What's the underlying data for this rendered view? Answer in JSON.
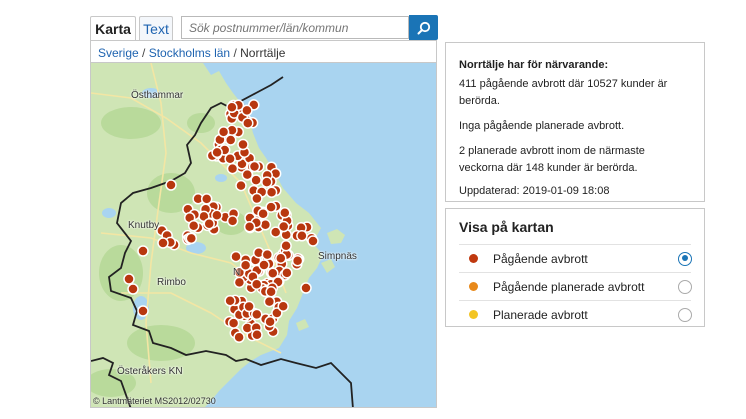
{
  "tabs": {
    "karta": "Karta",
    "text": "Text"
  },
  "search": {
    "placeholder": "Sök postnummer/län/kommun"
  },
  "breadcrumb": {
    "sverige": "Sverige",
    "lan": "Stockholms län",
    "kommun": "Norrtälje",
    "separator": "/"
  },
  "map": {
    "labels": {
      "osthammar": "Östhammar",
      "knutby": "Knutby",
      "rimbo": "Rimbo",
      "simpnas": "Simpnäs",
      "osteraker": "Österåkers KN",
      "n": "N"
    },
    "copyright": "© Lantmäteriet MS2012/02730"
  },
  "info": {
    "heading": "Norrtälje har för närvarande:",
    "line1": "411 pågående avbrott där 10527 kunder är berörda.",
    "line2": "Inga pågående planerade avbrott.",
    "line3": "2 planerade avbrott inom de närmaste veckorna där 148 kunder är berörda.",
    "updated": "Uppdaterad: 2019-01-09 18:08"
  },
  "legend": {
    "title": "Visa på kartan",
    "items": [
      {
        "label": "Pågående avbrott",
        "color": "#c0390f",
        "selected": true
      },
      {
        "label": "Pågående planerade avbrott",
        "color": "#e8891a",
        "selected": false
      },
      {
        "label": "Planerade avbrott",
        "color": "#f3c524",
        "selected": false
      }
    ]
  },
  "colors": {
    "accent": "#1a74b6",
    "land": "#cde5b2",
    "sea": "#a6d3ef",
    "marker": "#b8370f"
  }
}
